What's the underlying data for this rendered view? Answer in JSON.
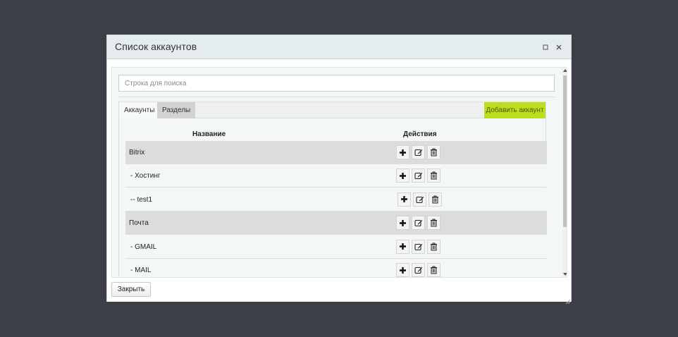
{
  "dialog": {
    "title": "Список аккаунтов",
    "maximize_icon": "maximize-icon",
    "close_icon": "close-icon"
  },
  "search": {
    "placeholder": "Строка для поиска",
    "value": ""
  },
  "tabs": [
    {
      "label": "Аккаунты",
      "active": true
    },
    {
      "label": "Разделы",
      "active": false
    }
  ],
  "add_account_label": "Добавить аккаунт",
  "table": {
    "headers": {
      "name": "Название",
      "actions": "Действия"
    },
    "rows": [
      {
        "label": "Bitrix",
        "type": "parent"
      },
      {
        "label": "- Хостинг",
        "type": "child"
      },
      {
        "label": "-- test1",
        "type": "child"
      },
      {
        "label": "Почта",
        "type": "parent"
      },
      {
        "label": "- GMAIL",
        "type": "child"
      },
      {
        "label": "- MAIL",
        "type": "child"
      }
    ],
    "actions": [
      "plus-icon",
      "edit-icon",
      "trash-icon"
    ]
  },
  "footer": {
    "close_label": "Закрыть"
  },
  "colors": {
    "backdrop": "#3c3f46",
    "accent_add": "#bcde1f",
    "header_bg": "#e4ecee",
    "parent_row": "#dcdcdc"
  }
}
